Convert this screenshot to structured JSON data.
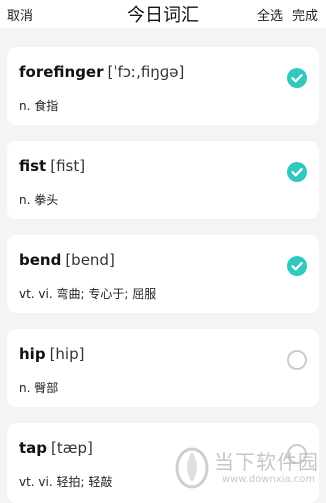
{
  "header": {
    "cancel_label": "取消",
    "title": "今日词汇",
    "select_all_label": "全选",
    "done_label": "完成"
  },
  "words": [
    {
      "word": "forefinger",
      "phonetic": "[ˈfɔː,fiŋɡə]",
      "meaning": "n. 食指",
      "checked": true
    },
    {
      "word": "fist",
      "phonetic": "[fist]",
      "meaning": "n. 拳头",
      "checked": true
    },
    {
      "word": "bend",
      "phonetic": "[bend]",
      "meaning": "vt. vi. 弯曲; 专心于; 屈服",
      "checked": true
    },
    {
      "word": "hip",
      "phonetic": "[hip]",
      "meaning": "n. 臀部",
      "checked": false
    },
    {
      "word": "tap",
      "phonetic": "[tæp]",
      "meaning": "vt. vi. 轻拍; 轻敲",
      "checked": false
    }
  ],
  "watermark": {
    "brand": "当下软件园",
    "url": "www.downxia.com"
  },
  "colors": {
    "accent": "#2fc9bf",
    "background": "#f4f4f6",
    "unchecked": "#c9ccd3"
  }
}
